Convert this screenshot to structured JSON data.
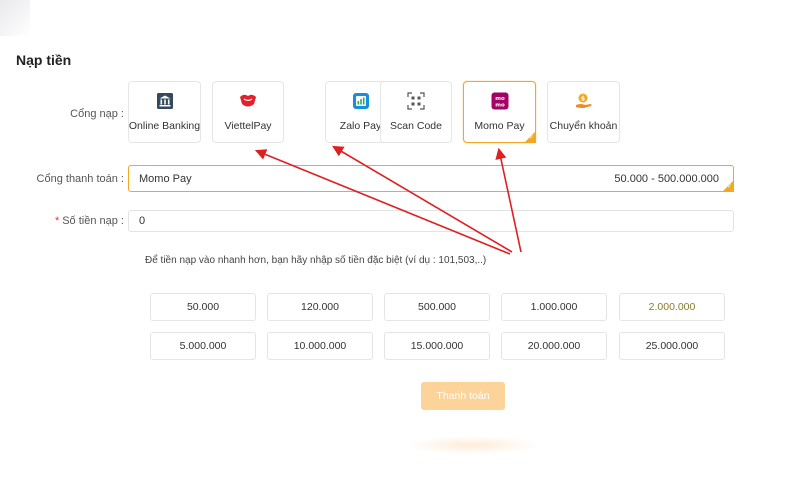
{
  "page_title": "Nạp tiền",
  "gateway_label": "Cổng nạp :",
  "gateways": [
    {
      "label": "Online Banking",
      "icon": "bank-icon"
    },
    {
      "label": "ViettelPay",
      "icon": "viettelpay-logo-icon"
    },
    {
      "label": "Zalo Pay",
      "icon": "zalopay-logo-icon"
    },
    {
      "label": "Scan Code",
      "icon": "qr-scan-icon"
    },
    {
      "label": "Momo Pay",
      "icon": "momo-logo-icon",
      "selected": true
    },
    {
      "label": "Chuyển khoản",
      "icon": "money-transfer-icon"
    }
  ],
  "payment_gateway": {
    "label": "Cổng thanh toán :",
    "value": "Momo Pay",
    "range": "50.000 - 500.000.000"
  },
  "amount_field": {
    "required_mark": "*",
    "label": "Số tiền nạp :",
    "value": "0"
  },
  "hint": "Để tiền nạp vào nhanh hơn, bạn hãy nhập số tiền đặc biệt (ví dụ : 101,503,..)",
  "amounts": [
    "50.000",
    "120.000",
    "500.000",
    "1.000.000",
    "2.000.000",
    "5.000.000",
    "10.000.000",
    "15.000.000",
    "20.000.000",
    "25.000.000"
  ],
  "submit_label": "Thanh toán",
  "colors": {
    "accent": "#f5a623",
    "button_bg": "#fcd49a",
    "arrow": "#e02020"
  }
}
